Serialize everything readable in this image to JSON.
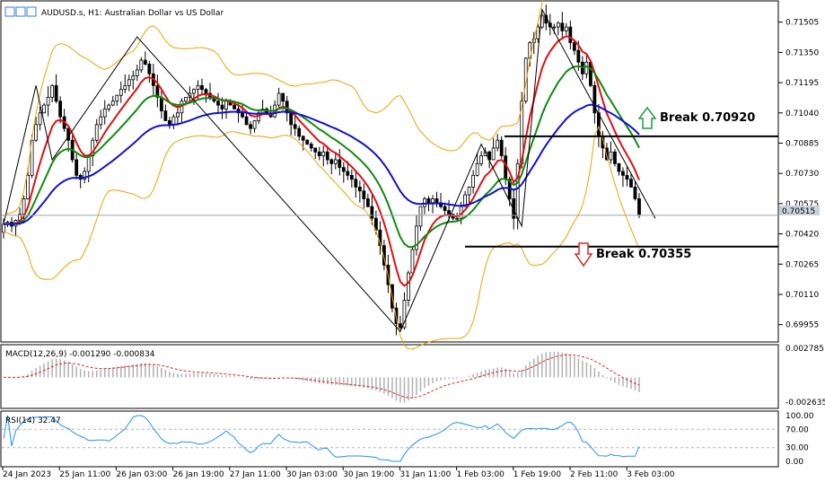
{
  "chart_data": {
    "type": "candlestick",
    "title": "AUDUSD.s, H1:  Australian Dollar vs US Dollar",
    "current_price": 0.70515,
    "current_price_label": "0.70515",
    "price_axis": {
      "min": 0.6988,
      "max": 0.716,
      "ticks": [
        "0.71505",
        "0.71350",
        "0.71195",
        "0.71040",
        "0.70885",
        "0.70730",
        "0.70575",
        "0.70420",
        "0.70265",
        "0.70110",
        "0.69955"
      ]
    },
    "time_axis": [
      "24 Jan 2023",
      "25 Jan 11:00",
      "26 Jan 03:00",
      "26 Jan 19:00",
      "27 Jan 11:00",
      "30 Jan 03:00",
      "30 Jan 19:00",
      "31 Jan 11:00",
      "1 Feb 03:00",
      "1 Feb 19:00",
      "2 Feb 11:00",
      "3 Feb 03:00"
    ],
    "levels": [
      {
        "name": "Break 0.70920",
        "value": 0.7092,
        "direction": "up"
      },
      {
        "name": "Break 0.70355",
        "value": 0.70355,
        "direction": "down"
      }
    ],
    "closes": [
      0.7047,
      0.7048,
      0.7046,
      0.7049,
      0.7052,
      0.706,
      0.7072,
      0.709,
      0.7098,
      0.7104,
      0.7108,
      0.7112,
      0.7118,
      0.711,
      0.7102,
      0.7096,
      0.709,
      0.708,
      0.7072,
      0.707,
      0.7074,
      0.7082,
      0.709,
      0.7098,
      0.7102,
      0.7106,
      0.7108,
      0.711,
      0.7113,
      0.7116,
      0.7118,
      0.7121,
      0.7123,
      0.7126,
      0.7131,
      0.7129,
      0.7124,
      0.7118,
      0.7112,
      0.7105,
      0.71,
      0.7098,
      0.7102,
      0.7104,
      0.711,
      0.7112,
      0.7114,
      0.7116,
      0.7118,
      0.7116,
      0.7114,
      0.7112,
      0.711,
      0.7108,
      0.7106,
      0.711,
      0.7108,
      0.7106,
      0.7104,
      0.7102,
      0.7098,
      0.7096,
      0.71,
      0.7104,
      0.7106,
      0.7104,
      0.7102,
      0.7108,
      0.7114,
      0.711,
      0.7104,
      0.7098,
      0.7096,
      0.7092,
      0.709,
      0.7088,
      0.7086,
      0.7084,
      0.7082,
      0.7084,
      0.708,
      0.7078,
      0.708,
      0.7076,
      0.7074,
      0.7072,
      0.707,
      0.7066,
      0.7064,
      0.706,
      0.7056,
      0.705,
      0.7044,
      0.7036,
      0.7026,
      0.7016,
      0.7004,
      0.6996,
      0.6994,
      0.7008,
      0.7022,
      0.7034,
      0.7046,
      0.7056,
      0.706,
      0.7058,
      0.706,
      0.7058,
      0.7056,
      0.7054,
      0.7052,
      0.705,
      0.705,
      0.7056,
      0.7062,
      0.7066,
      0.7072,
      0.7078,
      0.7082,
      0.7084,
      0.708,
      0.7086,
      0.709,
      0.7082,
      0.707,
      0.706,
      0.705,
      0.7078,
      0.711,
      0.7132,
      0.714,
      0.7142,
      0.7148,
      0.7154,
      0.715,
      0.7148,
      0.7148,
      0.715,
      0.7146,
      0.7148,
      0.714,
      0.7136,
      0.713,
      0.7124,
      0.713,
      0.7118,
      0.7104,
      0.7092,
      0.7086,
      0.708,
      0.7084,
      0.7078,
      0.7074,
      0.7072,
      0.707,
      0.7066,
      0.706,
      0.7052
    ],
    "macd": {
      "label": "MACD(12,26,9) -0.001290 -0.000834",
      "max_label": "0.002785",
      "min_label": "-0.002635",
      "max": 0.002785,
      "min": -0.002635
    },
    "rsi": {
      "label": "RSI(14) 32.47",
      "value": 32.47,
      "ticks": [
        "100.00",
        "70.00",
        "30.00",
        "0.00"
      ]
    }
  }
}
